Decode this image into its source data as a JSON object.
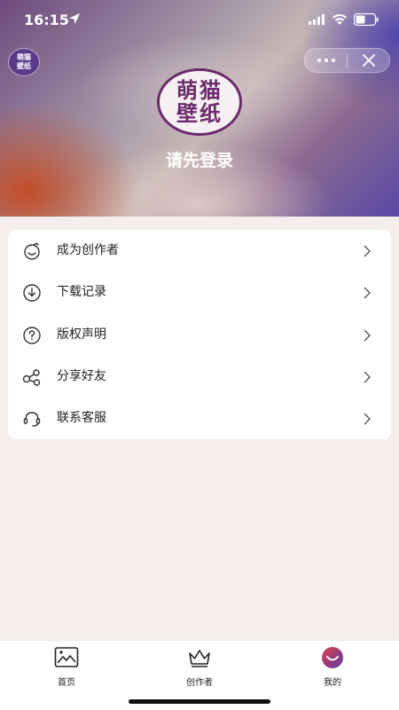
{
  "status_bar": {
    "time": "16:15"
  },
  "mini_logo": {
    "line1": "萌猫",
    "line2": "壁纸"
  },
  "app_logo": {
    "line1": "萌猫",
    "line2": "壁纸"
  },
  "profile": {
    "login_prompt": "请先登录"
  },
  "menu": {
    "items": [
      {
        "label": "成为创作者",
        "icon": "creator-face-icon"
      },
      {
        "label": "下载记录",
        "icon": "download-icon"
      },
      {
        "label": "版权声明",
        "icon": "question-icon"
      },
      {
        "label": "分享好友",
        "icon": "share-icon"
      },
      {
        "label": "联系客服",
        "icon": "headset-icon"
      }
    ]
  },
  "tabbar": {
    "tabs": [
      {
        "label": "首页",
        "icon": "image-icon"
      },
      {
        "label": "创作者",
        "icon": "crown-icon"
      },
      {
        "label": "我的",
        "icon": "avatar-icon",
        "active": true
      }
    ]
  },
  "colors": {
    "accent": "#6b2a6b",
    "tab_active": "#c2376a"
  }
}
